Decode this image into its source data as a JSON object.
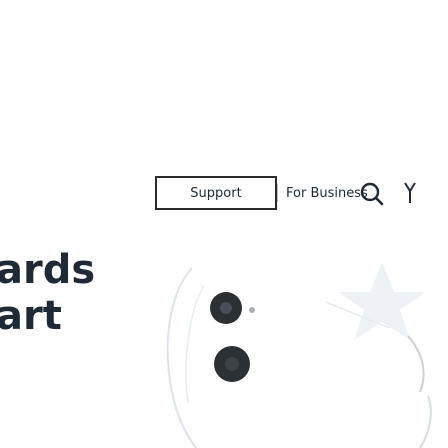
{
  "nav": {
    "items": [
      {
        "label": "Support"
      },
      {
        "label": "For Business"
      }
    ]
  },
  "icons": {
    "search": "search-icon"
  },
  "hero": {
    "line1": "ards",
    "line2": "art"
  },
  "colors": {
    "text": "#1f2a36",
    "accent": "#4a90d9",
    "focus": "#2a2a2a"
  }
}
